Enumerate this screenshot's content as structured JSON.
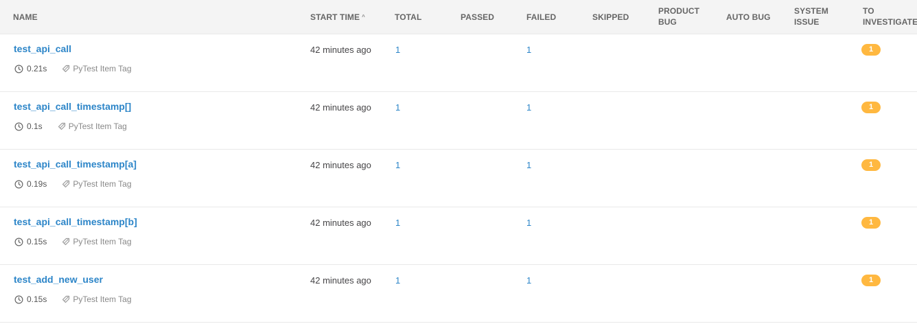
{
  "columns": {
    "name": "NAME",
    "start_time": "START TIME",
    "total": "TOTAL",
    "passed": "PASSED",
    "failed": "FAILED",
    "skipped": "SKIPPED",
    "product_bug_1": "PRODUCT",
    "product_bug_2": "BUG",
    "auto_bug": "AUTO BUG",
    "system_issue_1": "SYSTEM",
    "system_issue_2": "ISSUE",
    "to_investigate_1": "TO",
    "to_investigate_2": "INVESTIGATE",
    "sort_indicator": "^"
  },
  "rows": [
    {
      "name": "test_api_call",
      "duration": "0.21s",
      "tag": "PyTest Item Tag",
      "start": "42 minutes ago",
      "total": "1",
      "failed": "1",
      "to_investigate": "1"
    },
    {
      "name": "test_api_call_timestamp[]",
      "duration": "0.1s",
      "tag": "PyTest Item Tag",
      "start": "42 minutes ago",
      "total": "1",
      "failed": "1",
      "to_investigate": "1"
    },
    {
      "name": "test_api_call_timestamp[a]",
      "duration": "0.19s",
      "tag": "PyTest Item Tag",
      "start": "42 minutes ago",
      "total": "1",
      "failed": "1",
      "to_investigate": "1"
    },
    {
      "name": "test_api_call_timestamp[b]",
      "duration": "0.15s",
      "tag": "PyTest Item Tag",
      "start": "42 minutes ago",
      "total": "1",
      "failed": "1",
      "to_investigate": "1"
    },
    {
      "name": "test_add_new_user",
      "duration": "0.15s",
      "tag": "PyTest Item Tag",
      "start": "42 minutes ago",
      "total": "1",
      "failed": "1",
      "to_investigate": "1"
    }
  ],
  "colors": {
    "link": "#2c85c8",
    "badge": "#ffb840",
    "header_bg": "#f4f4f4"
  },
  "icons": {
    "duration": "clock-icon",
    "tag": "tag-icon"
  }
}
